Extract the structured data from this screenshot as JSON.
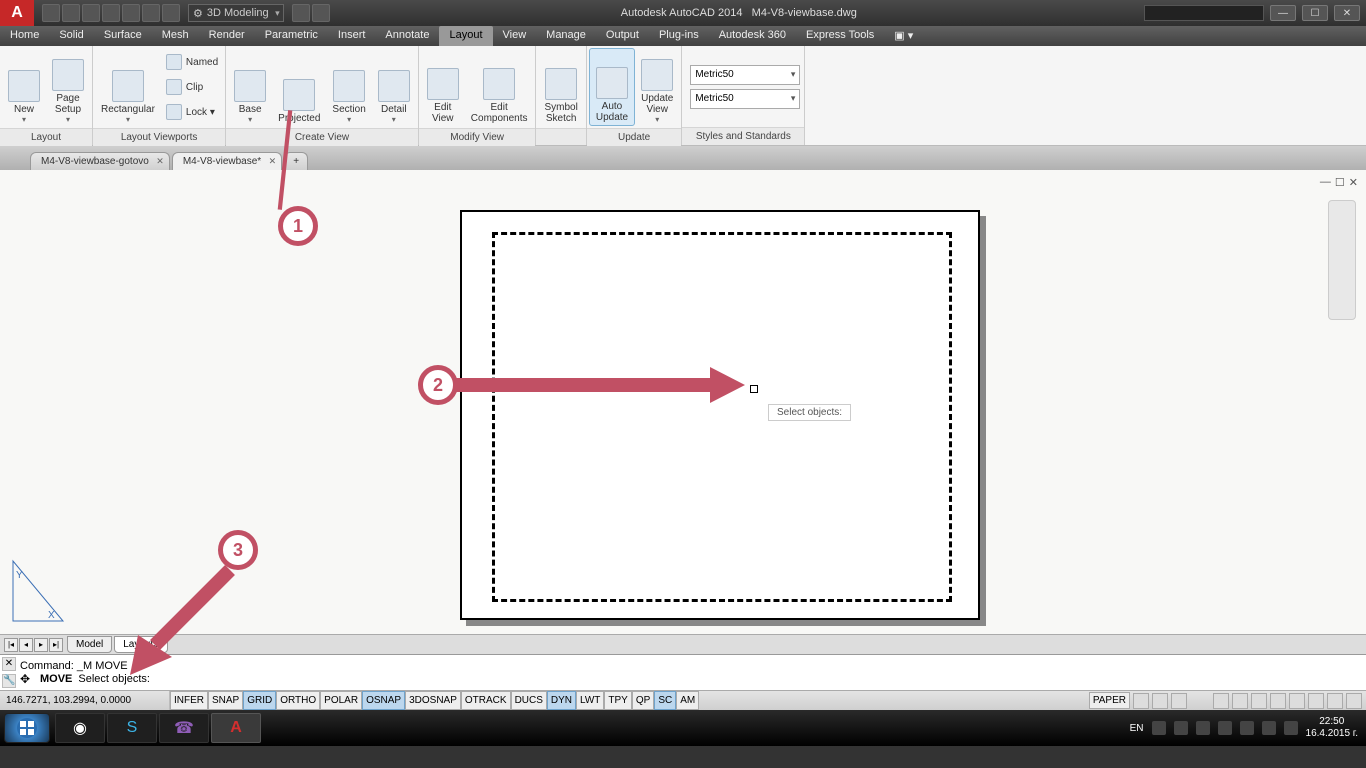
{
  "titlebar": {
    "workspace": "3D Modeling",
    "app": "Autodesk AutoCAD 2014",
    "file": "M4-V8-viewbase.dwg"
  },
  "menu": {
    "items": [
      "Home",
      "Solid",
      "Surface",
      "Mesh",
      "Render",
      "Parametric",
      "Insert",
      "Annotate",
      "Layout",
      "View",
      "Manage",
      "Output",
      "Plug-ins",
      "Autodesk 360",
      "Express Tools"
    ],
    "active": "Layout"
  },
  "ribbon": {
    "panels": [
      {
        "title": "Layout",
        "items": [
          {
            "label": "New",
            "drop": true
          },
          {
            "label": "Page Setup",
            "drop": true
          }
        ]
      },
      {
        "title": "Layout Viewports",
        "items": [
          {
            "label": "Rectangular",
            "drop": true
          }
        ],
        "smalls": [
          {
            "label": "Named"
          },
          {
            "label": "Clip"
          },
          {
            "label": "Lock",
            "drop": true
          }
        ]
      },
      {
        "title": "Create View",
        "items": [
          {
            "label": "Base",
            "drop": true
          },
          {
            "label": "Projected"
          },
          {
            "label": "Section",
            "drop": true
          },
          {
            "label": "Detail",
            "drop": true
          }
        ]
      },
      {
        "title": "Modify View",
        "items": [
          {
            "label": "Edit View"
          },
          {
            "label": "Edit Components"
          }
        ]
      },
      {
        "title": "",
        "items": [
          {
            "label": "Symbol Sketch"
          }
        ]
      },
      {
        "title": "Update",
        "items": [
          {
            "label": "Auto Update",
            "active": true
          },
          {
            "label": "Update View",
            "drop": true
          }
        ]
      },
      {
        "title": "Styles and Standards",
        "selects": [
          "Metric50",
          "Metric50"
        ]
      }
    ]
  },
  "doctabs": {
    "tabs": [
      {
        "label": "M4-V8-viewbase-gotovo"
      },
      {
        "label": "M4-V8-viewbase*",
        "active": true
      }
    ]
  },
  "canvas": {
    "cursor_label": "Select objects:"
  },
  "modeltabs": {
    "tabs": [
      {
        "label": "Model"
      },
      {
        "label": "Layout2",
        "active": true
      }
    ]
  },
  "cmd": {
    "hist": "Command: _M MOVE",
    "line_cmd": "MOVE",
    "line_rest": "Select objects:"
  },
  "status": {
    "coords": "146.7271, 103.2994, 0.0000",
    "buttons": [
      {
        "label": "INFER"
      },
      {
        "label": "SNAP"
      },
      {
        "label": "GRID",
        "on": true
      },
      {
        "label": "ORTHO"
      },
      {
        "label": "POLAR"
      },
      {
        "label": "OSNAP",
        "on": true
      },
      {
        "label": "3DOSNAP"
      },
      {
        "label": "OTRACK"
      },
      {
        "label": "DUCS"
      },
      {
        "label": "DYN",
        "on": true
      },
      {
        "label": "LWT"
      },
      {
        "label": "TPY"
      },
      {
        "label": "QP"
      },
      {
        "label": "SC",
        "on": true
      },
      {
        "label": "AM"
      }
    ],
    "space": "PAPER"
  },
  "tray": {
    "lang": "EN",
    "time": "22:50",
    "date": "16.4.2015 г."
  },
  "annotations": {
    "a1": "1",
    "a2": "2",
    "a3": "3"
  }
}
